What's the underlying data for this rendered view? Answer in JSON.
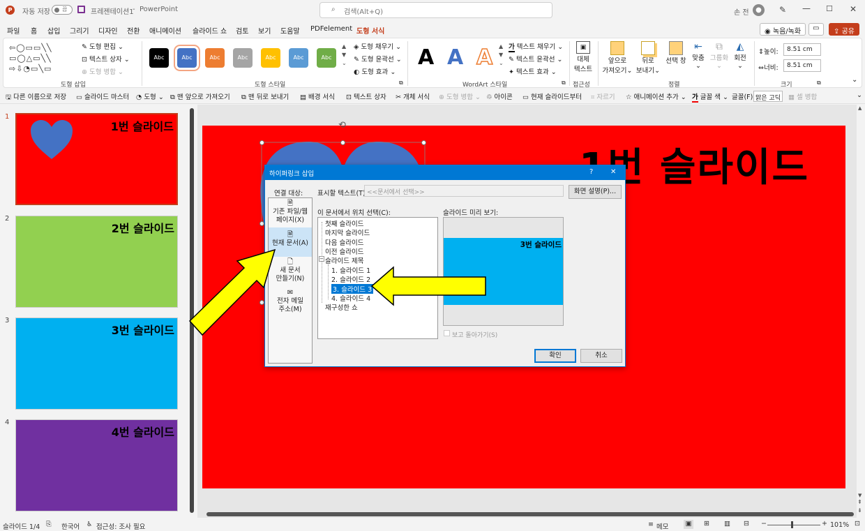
{
  "titlebar": {
    "app_icon": "powerpoint-icon",
    "autosave_label": "자동 저장",
    "autosave_state": "끔",
    "file_name": "프레젠테이션1",
    "separator": "-",
    "app_name": "PowerPoint",
    "search_placeholder": "검색(Alt+Q)",
    "user_name": "손 전"
  },
  "menu": {
    "tabs": [
      "파일",
      "홈",
      "삽입",
      "그리기",
      "디자인",
      "전환",
      "애니메이션",
      "슬라이드 쇼",
      "검토",
      "보기",
      "도움말",
      "PDFelement",
      "도형 서식"
    ],
    "active_tab": "도형 서식",
    "record_label": "녹음/녹화",
    "share_label": "공유"
  },
  "ribbon": {
    "shape_insert": {
      "edit_shape": "도형 편집",
      "text_box": "텍스트 상자",
      "merge_shapes": "도형 병합",
      "label": "도형 삽입"
    },
    "shape_styles": {
      "swatches": [
        {
          "text": "Abc",
          "color": "#000000"
        },
        {
          "text": "Abc",
          "color": "#4472c4"
        },
        {
          "text": "Abc",
          "color": "#ed7d31"
        },
        {
          "text": "Abc",
          "color": "#a5a5a5"
        },
        {
          "text": "Abc",
          "color": "#ffc000"
        },
        {
          "text": "Abc",
          "color": "#5b9bd5"
        },
        {
          "text": "Abc",
          "color": "#70ad47"
        }
      ],
      "fill": "도형 채우기",
      "outline": "도형 윤곽선",
      "effects": "도형 효과",
      "label": "도형 스타일"
    },
    "wordart": {
      "letters": [
        "A",
        "A",
        "A"
      ],
      "text_fill": "텍스트 채우기",
      "text_outline": "텍스트 윤곽선",
      "text_effects": "텍스트 효과",
      "label": "WordArt 스타일"
    },
    "accessibility": {
      "alt_text_line1": "대체",
      "alt_text_line2": "텍스트",
      "label": "접근성"
    },
    "arrange": {
      "bring_forward_1": "앞으로",
      "bring_forward_2": "가져오기",
      "send_backward_1": "뒤로",
      "send_backward_2": "보내기",
      "selection_pane_1": "선택 창",
      "align": "맞춤",
      "group": "그룹화",
      "rotate": "회전",
      "label": "정렬"
    },
    "size": {
      "height_label": "높이:",
      "height_value": "8.51 cm",
      "width_label": "너비:",
      "width_value": "8.51 cm",
      "label": "크기"
    }
  },
  "qat": {
    "items": [
      "다른 이름으로 저장",
      "슬라이드 마스터",
      "도형",
      "맨 앞으로 가져오기",
      "맨 뒤로 보내기",
      "배경 서식",
      "텍스트 상자",
      "개체 서식",
      "도형 병합",
      "아이콘",
      "현재 슬라이드부터",
      "자르기",
      "애니메이션 추가",
      "글꼴 색",
      "글꼴(F):",
      "맑은 고딕",
      "셀 병합"
    ]
  },
  "slides": [
    {
      "num": "1",
      "title": "1번 슬라이드",
      "color": "#ff0000"
    },
    {
      "num": "2",
      "title": "2번 슬라이드",
      "color": "#92d050"
    },
    {
      "num": "3",
      "title": "3번 슬라이드",
      "color": "#00b0f0"
    },
    {
      "num": "4",
      "title": "4번 슬라이드",
      "color": "#7030a0"
    }
  ],
  "main_slide": {
    "title": "1번 슬라이드",
    "color": "#ff0000"
  },
  "dialog": {
    "title": "하이퍼링크 삽입",
    "help": "?",
    "close": "✕",
    "link_to_label": "연결 대상:",
    "link_options": [
      {
        "line1": "기존 파일/웹",
        "line2": "페이지(X)"
      },
      {
        "line1": "현재 문서(A)",
        "line2": ""
      },
      {
        "line1": "새 문서",
        "line2": "만들기(N)"
      },
      {
        "line1": "전자 메일",
        "line2": "주소(M)"
      }
    ],
    "display_text_label": "표시할 텍스트(T):",
    "display_text_value": "<<문서에서 선택>>",
    "screentip_button": "화면 설명(P)...",
    "place_label": "이 문서에서 위치 선택(C):",
    "tree": [
      "첫째 슬라이드",
      "마지막 슬라이드",
      "다음 슬라이드",
      "이전 슬라이드",
      "슬라이드 제목",
      "1. 슬라이드 1",
      "2. 슬라이드 2",
      "3. 슬라이드 3",
      "4. 슬라이드 4",
      "재구성한 쇼"
    ],
    "selected_item": "3. 슬라이드 3",
    "preview_label": "슬라이드 미리 보기:",
    "preview_title": "3번 슬라이드",
    "show_return_label": "보고 돌아가기(S)",
    "ok": "확인",
    "cancel": "취소"
  },
  "status": {
    "slide_count": "슬라이드 1/4",
    "language": "한국어",
    "accessibility": "접근성: 조사 필요",
    "notes": "메모",
    "zoom": "101%"
  }
}
